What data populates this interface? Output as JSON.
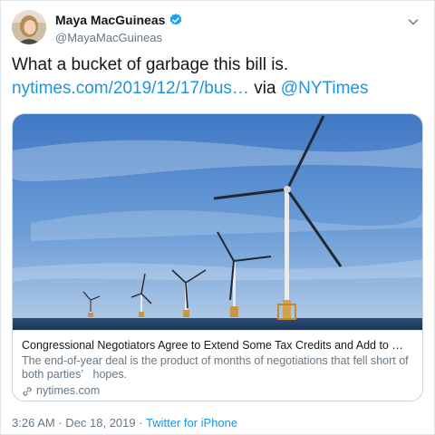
{
  "author": {
    "display_name": "Maya MacGuineas",
    "handle": "@MayaMacGuineas",
    "verified": true
  },
  "icons": {
    "verified": "verified-badge-icon",
    "menu": "chevron-down-icon",
    "link": "link-icon"
  },
  "tweet": {
    "text": "What a bucket of garbage this bill is.",
    "link_text": "nytimes.com/2019/12/17/bus…",
    "via_text": "via",
    "mention": "@NYTimes"
  },
  "card": {
    "title": "Congressional Negotiators Agree to Extend Some Tax Credits and Add to …",
    "description": "The end-of-year deal is the product of months of negotiations that fell short of both parties’   hopes.",
    "domain": "nytimes.com"
  },
  "footer": {
    "time": "3:26 AM",
    "date": "Dec 18, 2019",
    "source": "Twitter for iPhone"
  },
  "colors": {
    "link": "#1b95e0",
    "secondary_text": "#657786",
    "border": "#ccd6dd"
  }
}
